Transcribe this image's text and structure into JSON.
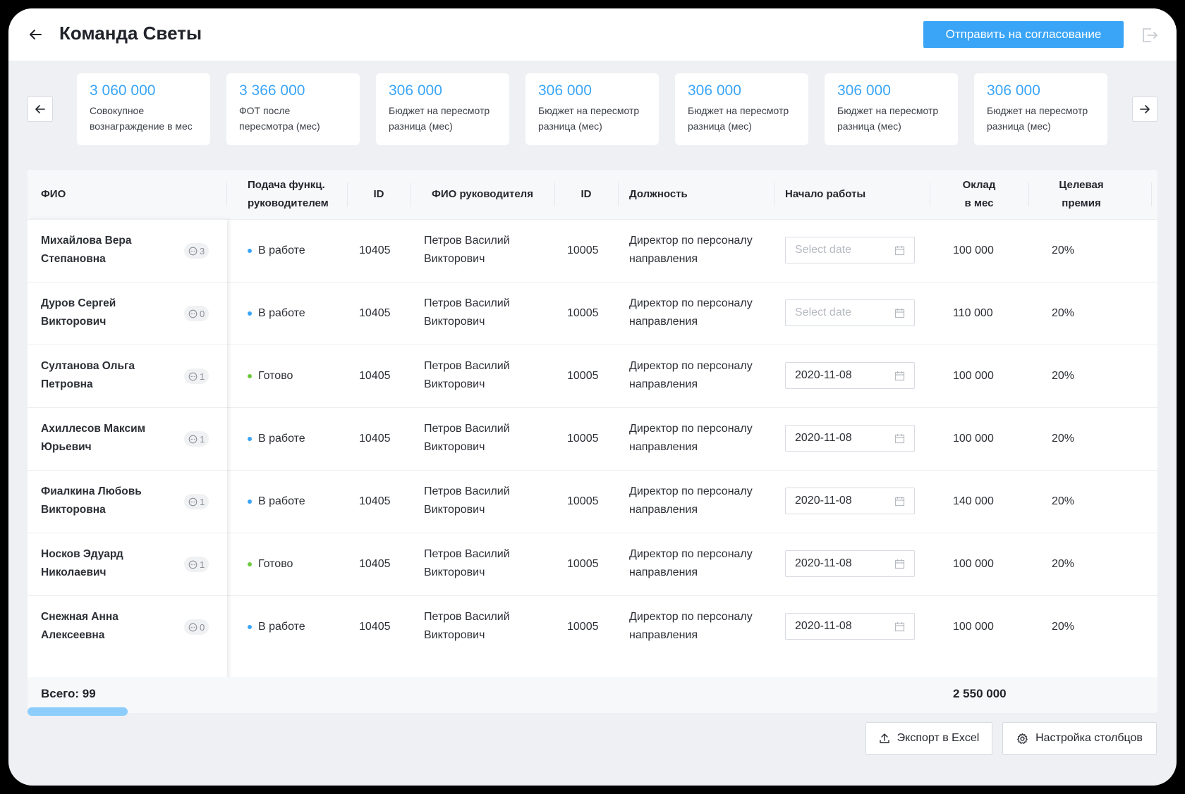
{
  "header": {
    "title": "Команда Светы",
    "submit_label": "Отправить на согласование"
  },
  "cards": [
    {
      "value": "3 060 000",
      "label1": "Совокупное",
      "label2": "вознаграждение в мес"
    },
    {
      "value": "3 366 000",
      "label1": "ФОТ после",
      "label2": "пересмотра (мес)"
    },
    {
      "value": "306 000",
      "label1": "Бюджет на пересмотр",
      "label2": "разница (мес)"
    },
    {
      "value": "306 000",
      "label1": "Бюджет на пересмотр",
      "label2": "разница (мес)"
    },
    {
      "value": "306 000",
      "label1": "Бюджет на пересмотр",
      "label2": "разница (мес)"
    },
    {
      "value": "306 000",
      "label1": "Бюджет на пересмотр",
      "label2": "разница (мес)"
    },
    {
      "value": "306 000",
      "label1": "Бюджет на пересмотр",
      "label2": "разница (мес)"
    }
  ],
  "table": {
    "columns": {
      "fio": "ФИО",
      "submit1": "Подача функц.",
      "submit2": "руководителем",
      "id": "ID",
      "manager": "ФИО руководителя",
      "manager_id": "ID",
      "position": "Должность",
      "start": "Начало работы",
      "salary1": "Оклад",
      "salary2": "в мес",
      "bonus1": "Целевая",
      "bonus2": "премия"
    },
    "rows": [
      {
        "name1": "Михайлова Вера",
        "name2": "Степановна",
        "comments": "3",
        "status": "В работе",
        "status_color": "#3aa5f7",
        "id": "10405",
        "manager1": "Петров Василий",
        "manager2": "Викторович",
        "manager_id": "10005",
        "position1": "Директор по персоналу",
        "position2": "направления",
        "date": "Select date",
        "date_empty": true,
        "salary": "100 000",
        "bonus": "20%"
      },
      {
        "name1": "Дуров Сергей",
        "name2": "Викторович",
        "comments": "0",
        "status": "В работе",
        "status_color": "#3aa5f7",
        "id": "10405",
        "manager1": "Петров Василий",
        "manager2": "Викторович",
        "manager_id": "10005",
        "position1": "Директор по персоналу",
        "position2": "направления",
        "date": "Select date",
        "date_empty": true,
        "salary": "110 000",
        "bonus": "20%"
      },
      {
        "name1": "Султанова Ольга",
        "name2": "Петровна",
        "comments": "1",
        "status": "Готово",
        "status_color": "#6cc93f",
        "id": "10405",
        "manager1": "Петров Василий",
        "manager2": "Викторович",
        "manager_id": "10005",
        "position1": "Директор по персоналу",
        "position2": "направления",
        "date": "2020-11-08",
        "date_empty": false,
        "salary": "100 000",
        "bonus": "20%"
      },
      {
        "name1": "Ахиллесов Максим",
        "name2": "Юрьевич",
        "comments": "1",
        "status": "В работе",
        "status_color": "#3aa5f7",
        "id": "10405",
        "manager1": "Петров Василий",
        "manager2": "Викторович",
        "manager_id": "10005",
        "position1": "Директор по персоналу",
        "position2": "направления",
        "date": "2020-11-08",
        "date_empty": false,
        "salary": "100 000",
        "bonus": "20%"
      },
      {
        "name1": "Фиалкина Любовь",
        "name2": "Викторовна",
        "comments": "1",
        "status": "В работе",
        "status_color": "#3aa5f7",
        "id": "10405",
        "manager1": "Петров Василий",
        "manager2": "Викторович",
        "manager_id": "10005",
        "position1": "Директор по персоналу",
        "position2": "направления",
        "date": "2020-11-08",
        "date_empty": false,
        "salary": "140 000",
        "bonus": "20%"
      },
      {
        "name1": "Носков Эдуард",
        "name2": "Николаевич",
        "comments": "1",
        "status": "Готово",
        "status_color": "#6cc93f",
        "id": "10405",
        "manager1": "Петров Василий",
        "manager2": "Викторович",
        "manager_id": "10005",
        "position1": "Директор по персоналу",
        "position2": "направления",
        "date": "2020-11-08",
        "date_empty": false,
        "salary": "100 000",
        "bonus": "20%"
      },
      {
        "name1": "Снежная Анна",
        "name2": "Алексеевна",
        "comments": "0",
        "status": "В работе",
        "status_color": "#3aa5f7",
        "id": "10405",
        "manager1": "Петров Василий",
        "manager2": "Викторович",
        "manager_id": "10005",
        "position1": "Директор по персоналу",
        "position2": "направления",
        "date": "2020-11-08",
        "date_empty": false,
        "salary": "100 000",
        "bonus": "20%"
      }
    ],
    "total_label": "Всего: 99",
    "total_sum": "2 550 000"
  },
  "footer": {
    "export_label": "Экспорт в Excel",
    "columns_label": "Настройка столбцов"
  },
  "icons": {
    "back": "arrow-left-icon",
    "logout": "logout-icon",
    "prev": "arrow-left-icon",
    "next": "arrow-right-icon",
    "comment": "comment-icon",
    "calendar": "calendar-icon",
    "upload": "upload-icon",
    "gear": "gear-icon"
  },
  "colors": {
    "accent": "#3aa5f7",
    "status_in_progress": "#3aa5f7",
    "status_done": "#6cc93f",
    "background": "#eef0f4"
  }
}
